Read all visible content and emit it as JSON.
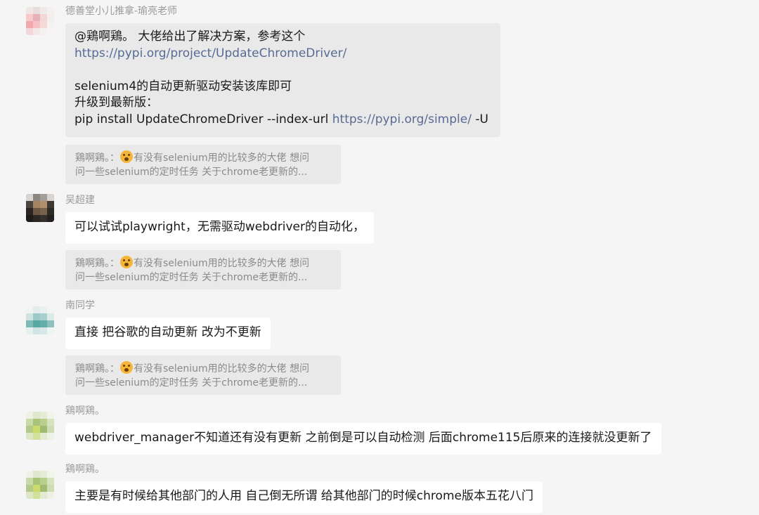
{
  "messages": [
    {
      "sender": "德善堂小儿推拿-瑜亮老师",
      "lines": [
        {
          "text": "@鶏啊鶏。 大佬给出了解决方案，参考这个",
          "link": ""
        },
        {
          "text": "",
          "link": "https://pypi.org/project/UpdateChromeDriver/"
        },
        {
          "text": "",
          "link": ""
        },
        {
          "text": "selenium4的自动更新驱动安装该库即可",
          "link": ""
        },
        {
          "text": "升级到最新版：",
          "link": ""
        },
        {
          "text": "pip install UpdateChromeDriver --index-url ",
          "link": "https://pypi.org/simple/",
          "suffix": " -U"
        }
      ],
      "quote": {
        "line1_prefix": "鶏啊鶏。：",
        "line1_rest": "有没有selenium用的比较多的大佬  想问",
        "line2": "问一些selenium的定时任务  关于chrome老更新的..."
      }
    },
    {
      "sender": "吴超建",
      "text": "可以试试playwright，无需驱动webdriver的自动化，",
      "quote": {
        "line1_prefix": "鶏啊鶏。：",
        "line1_rest": "有没有selenium用的比较多的大佬  想问",
        "line2": "问一些selenium的定时任务  关于chrome老更新的..."
      }
    },
    {
      "sender": "南同学",
      "text": "直接 把谷歌的自动更新 改为不更新",
      "quote": {
        "line1_prefix": "鶏啊鶏。：",
        "line1_rest": "有没有selenium用的比较多的大佬  想问",
        "line2": "问一些selenium的定时任务  关于chrome老更新的..."
      }
    },
    {
      "sender": "鶏啊鶏。",
      "text": "webdriver_manager不知道还有没有更新  之前倒是可以自动检测  后面chrome115后原来的连接就没更新了"
    },
    {
      "sender": "鶏啊鶏。",
      "text": "主要是有时候给其他部门的人用  自己倒无所谓  给其他部门的时候chrome版本五花八门"
    }
  ],
  "colors": {
    "background": "#f5f5f5",
    "bubble_white": "#ffffff",
    "bubble_grey": "#e9e9e9",
    "link": "#576b95",
    "sender_name": "#9a9a9a",
    "quote_text": "#8a8a8a"
  },
  "icons": {
    "quote_emoji": "crying-face-emoji"
  }
}
